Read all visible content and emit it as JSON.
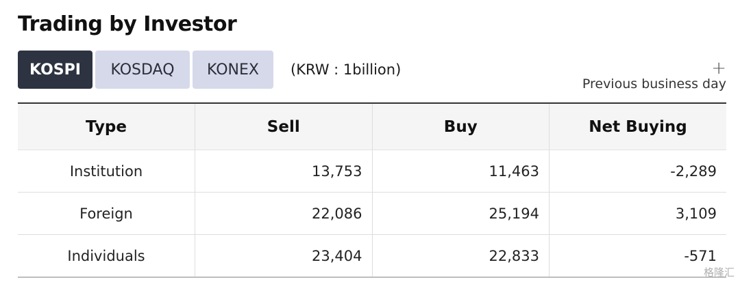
{
  "title": "Trading by Investor",
  "tabs": [
    {
      "label": "KOSPI",
      "active": true
    },
    {
      "label": "KOSDAQ",
      "active": false
    },
    {
      "label": "KONEX",
      "active": false
    }
  ],
  "unit_note": "(KRW : 1billion)",
  "more": {
    "icon": "plus-icon",
    "label": "Previous business day"
  },
  "table": {
    "headers": [
      "Type",
      "Sell",
      "Buy",
      "Net Buying"
    ],
    "rows": [
      {
        "type": "Institution",
        "sell": "13,753",
        "buy": "11,463",
        "net": "-2,289"
      },
      {
        "type": "Foreign",
        "sell": "22,086",
        "buy": "25,194",
        "net": "3,109"
      },
      {
        "type": "Individuals",
        "sell": "23,404",
        "buy": "22,833",
        "net": "-571"
      }
    ]
  },
  "watermark": "格隆汇",
  "colors": {
    "active_tab_bg": "#2d3340",
    "inactive_tab_bg": "#d6d9ea",
    "header_bg": "#f5f5f5"
  }
}
